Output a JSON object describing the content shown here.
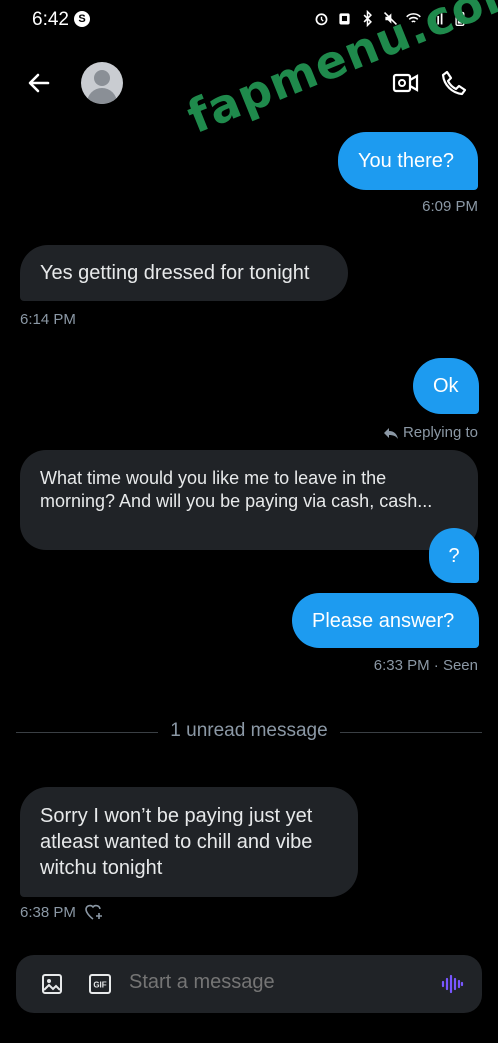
{
  "status_bar": {
    "time": "6:42",
    "app_badge": "S"
  },
  "header": {
    "contact_name": "",
    "back_icon": "arrow-left-icon",
    "video_icon": "video-icon",
    "call_icon": "phone-icon"
  },
  "watermark": "fapmenu.com",
  "messages": [
    {
      "from": "me",
      "text": "You there?",
      "meta": "6:09 PM"
    },
    {
      "from": "them",
      "text": "Yes getting dressed for tonight",
      "meta": "6:14 PM"
    },
    {
      "from": "me",
      "text": "Ok",
      "meta": ""
    },
    {
      "from": "me",
      "text": "Replying to",
      "meta": ""
    },
    {
      "from": "them_quoted",
      "text": "What time would you like me to leave in the morning? And will you be paying via cash, cash...",
      "meta": ""
    },
    {
      "from": "me",
      "text": "?",
      "meta": ""
    },
    {
      "from": "me",
      "text": "Please answer?",
      "meta": "6:33 PM · Seen"
    },
    {
      "from": "them",
      "text": "Sorry I won’t be paying just yet atleast  wanted to chill and vibe witchu tonight",
      "meta": "6:38 PM"
    }
  ],
  "unread_divider": "1 unread message",
  "composer": {
    "placeholder": "Start a message"
  },
  "colors": {
    "sent_bubble": "#1d9bf0",
    "recv_bubble": "#202327",
    "background": "#000000",
    "voice_accent": "#7856ff"
  }
}
